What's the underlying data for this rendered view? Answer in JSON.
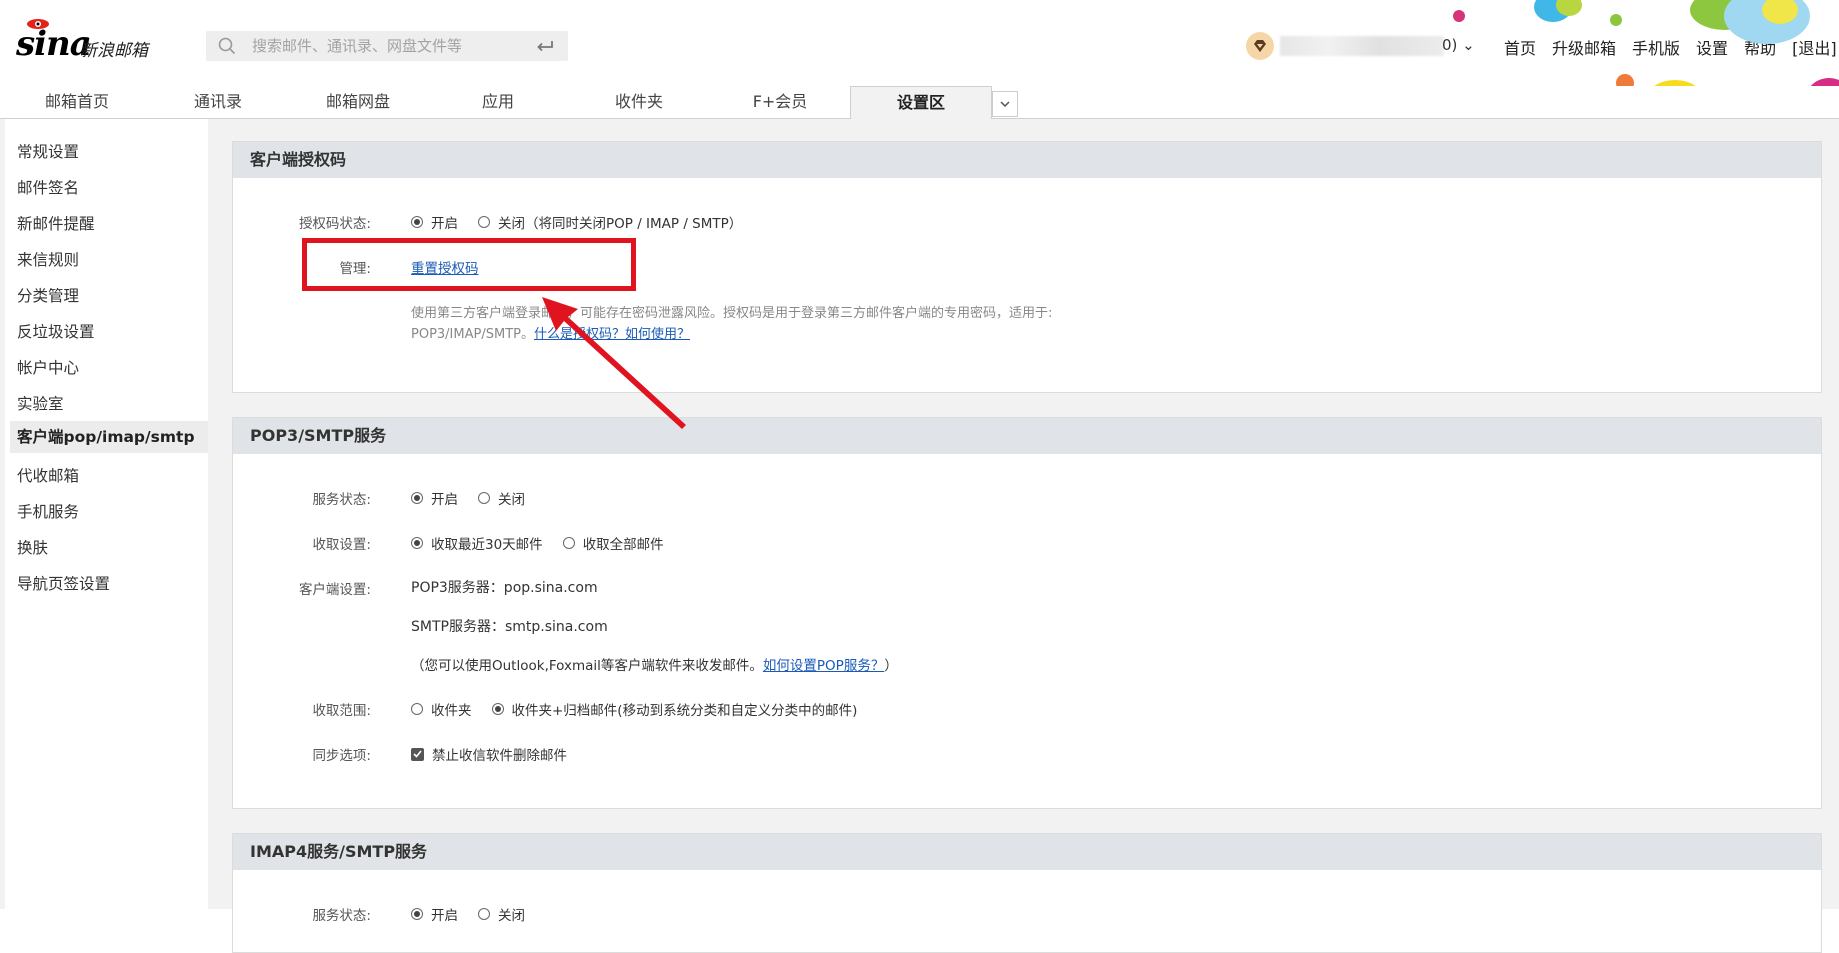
{
  "header": {
    "logo_text": "新浪邮箱",
    "logo_brand": "sina",
    "search_placeholder": "搜索邮件、通讯录、网盘文件等",
    "username_suffix": "0) ⌄",
    "links": [
      "首页",
      "升级邮箱",
      "手机版",
      "设置",
      "帮助",
      "[退出]"
    ]
  },
  "nav": {
    "tabs": [
      "邮箱首页",
      "通讯录",
      "邮箱网盘",
      "应用",
      "收件夹",
      "F+会员",
      "设置区"
    ],
    "active_tab": "设置区",
    "more_icon": "chevron-down-icon"
  },
  "sidebar": {
    "items": [
      "常规设置",
      "邮件签名",
      "新邮件提醒",
      "来信规则",
      "分类管理",
      "反垃圾设置",
      "帐户中心",
      "实验室",
      "客户端pop/imap/smtp",
      "代收邮箱",
      "手机服务",
      "换肤",
      "导航页签设置"
    ],
    "active": "客户端pop/imap/smtp"
  },
  "auth_panel": {
    "title": "客户端授权码",
    "status_label": "授权码状态:",
    "status_on": "开启",
    "status_off": "关闭（将同时关闭POP / IMAP / SMTP）",
    "status_value": "开启",
    "manage_label": "管理:",
    "reset_link": "重置授权码",
    "hint_line1": "使用第三方客户端登录邮箱，可能存在密码泄露风险。授权码是用于登录第三方邮件客户端的专用密码，适用于:",
    "hint_line2": "POP3/IMAP/SMTP。",
    "hint_link": "什么是授权码？如何使用？"
  },
  "pop_panel": {
    "title": "POP3/SMTP服务",
    "service_label": "服务状态:",
    "service_on": "开启",
    "service_off": "关闭",
    "service_value": "开启",
    "fetch_label": "收取设置:",
    "fetch_recent": "收取最近30天邮件",
    "fetch_all": "收取全部邮件",
    "fetch_value": "收取最近30天邮件",
    "client_label": "客户端设置:",
    "pop3_server": "POP3服务器：pop.sina.com",
    "smtp_server": "SMTP服务器：smtp.sina.com",
    "client_note": "（您可以使用Outlook,Foxmail等客户端软件来收发邮件。",
    "client_link": "如何设置POP服务？",
    "client_note_end": "）",
    "range_label": "收取范围:",
    "range_inbox": "收件夹",
    "range_archive": "收件夹+归档邮件(移动到系统分类和自定义分类中的邮件)",
    "range_value": "收件夹+归档邮件(移动到系统分类和自定义分类中的邮件)",
    "sync_label": "同步选项:",
    "sync_option": "禁止收信软件删除邮件",
    "sync_checked": true
  },
  "imap_panel": {
    "title": "IMAP4服务/SMTP服务",
    "service_label": "服务状态:",
    "service_on": "开启",
    "service_off": "关闭"
  },
  "colors": {
    "accent_link": "#1a5bb8",
    "annotation": "#e0141f",
    "panel_head": "#e0e4e8"
  }
}
